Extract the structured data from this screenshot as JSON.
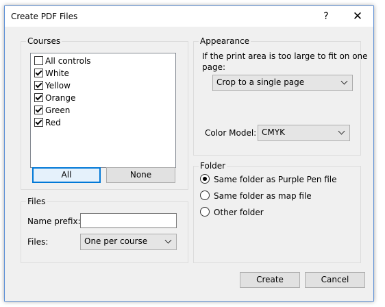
{
  "window": {
    "title": "Create PDF Files",
    "help_glyph": "?",
    "close_glyph": "✕"
  },
  "courses": {
    "group_label": "Courses",
    "items": [
      {
        "label": "All controls",
        "checked": false
      },
      {
        "label": "White",
        "checked": true
      },
      {
        "label": "Yellow",
        "checked": true
      },
      {
        "label": "Orange",
        "checked": true
      },
      {
        "label": "Green",
        "checked": true
      },
      {
        "label": "Red",
        "checked": true
      }
    ],
    "all_label": "All",
    "none_label": "None"
  },
  "files": {
    "group_label": "Files",
    "name_prefix_label": "Name prefix:",
    "name_prefix_value": "",
    "files_label": "Files:",
    "files_value": "One per course"
  },
  "appearance": {
    "group_label": "Appearance",
    "print_area_text_line1": "If the print area is too large to fit on one",
    "print_area_text_line2": "page:",
    "print_area_value": "Crop to a single page",
    "color_model_label": "Color Model:",
    "color_model_value": "CMYK"
  },
  "folder": {
    "group_label": "Folder",
    "options": [
      {
        "label": "Same folder as Purple Pen file",
        "selected": true
      },
      {
        "label": "Same folder as map file",
        "selected": false
      },
      {
        "label": "Other folder",
        "selected": false
      }
    ]
  },
  "footer": {
    "create_label": "Create",
    "cancel_label": "Cancel"
  }
}
